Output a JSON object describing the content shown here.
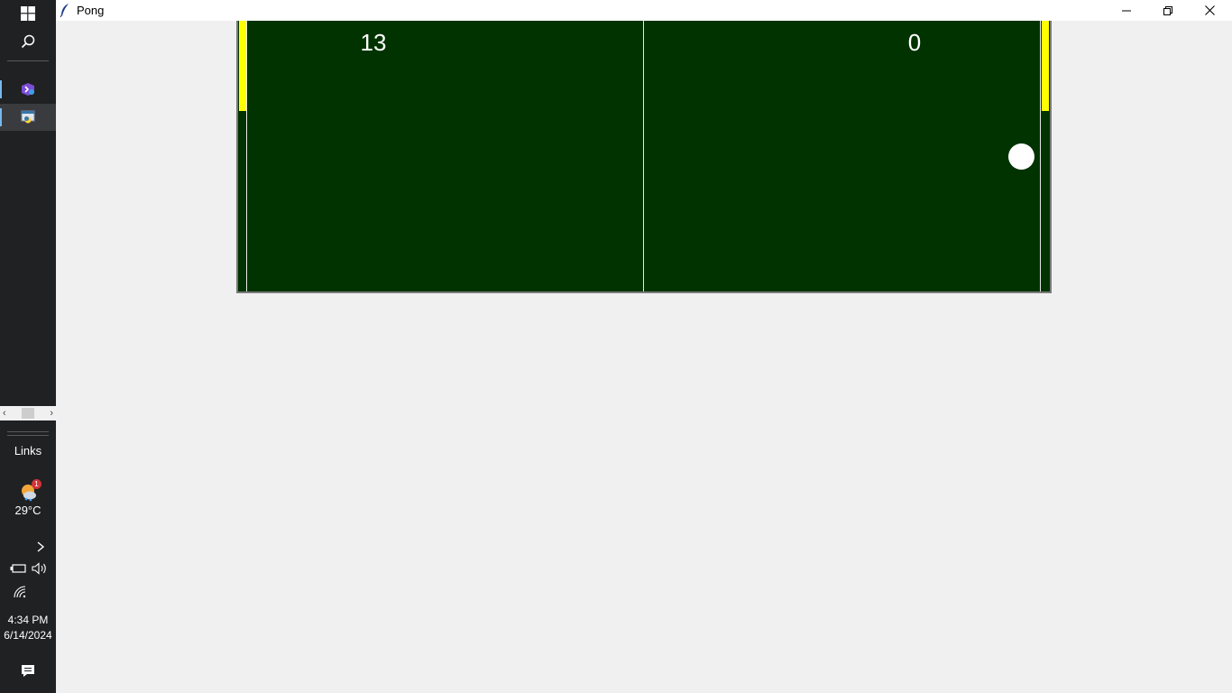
{
  "window": {
    "title": "Pong"
  },
  "taskbar": {
    "links_label": "Links",
    "weather": {
      "temperature": "29°C",
      "badge_count": "1"
    },
    "clock": {
      "time": "4:34 PM",
      "date": "6/14/2024"
    },
    "apps": [
      "visual-studio-icon",
      "python-app-icon"
    ]
  },
  "game": {
    "left_score": "13",
    "right_score": "0",
    "colors": {
      "court": "#003300",
      "paddle": "#ffff00",
      "ball": "#ffffff",
      "lines": "#e8e8e8"
    }
  }
}
